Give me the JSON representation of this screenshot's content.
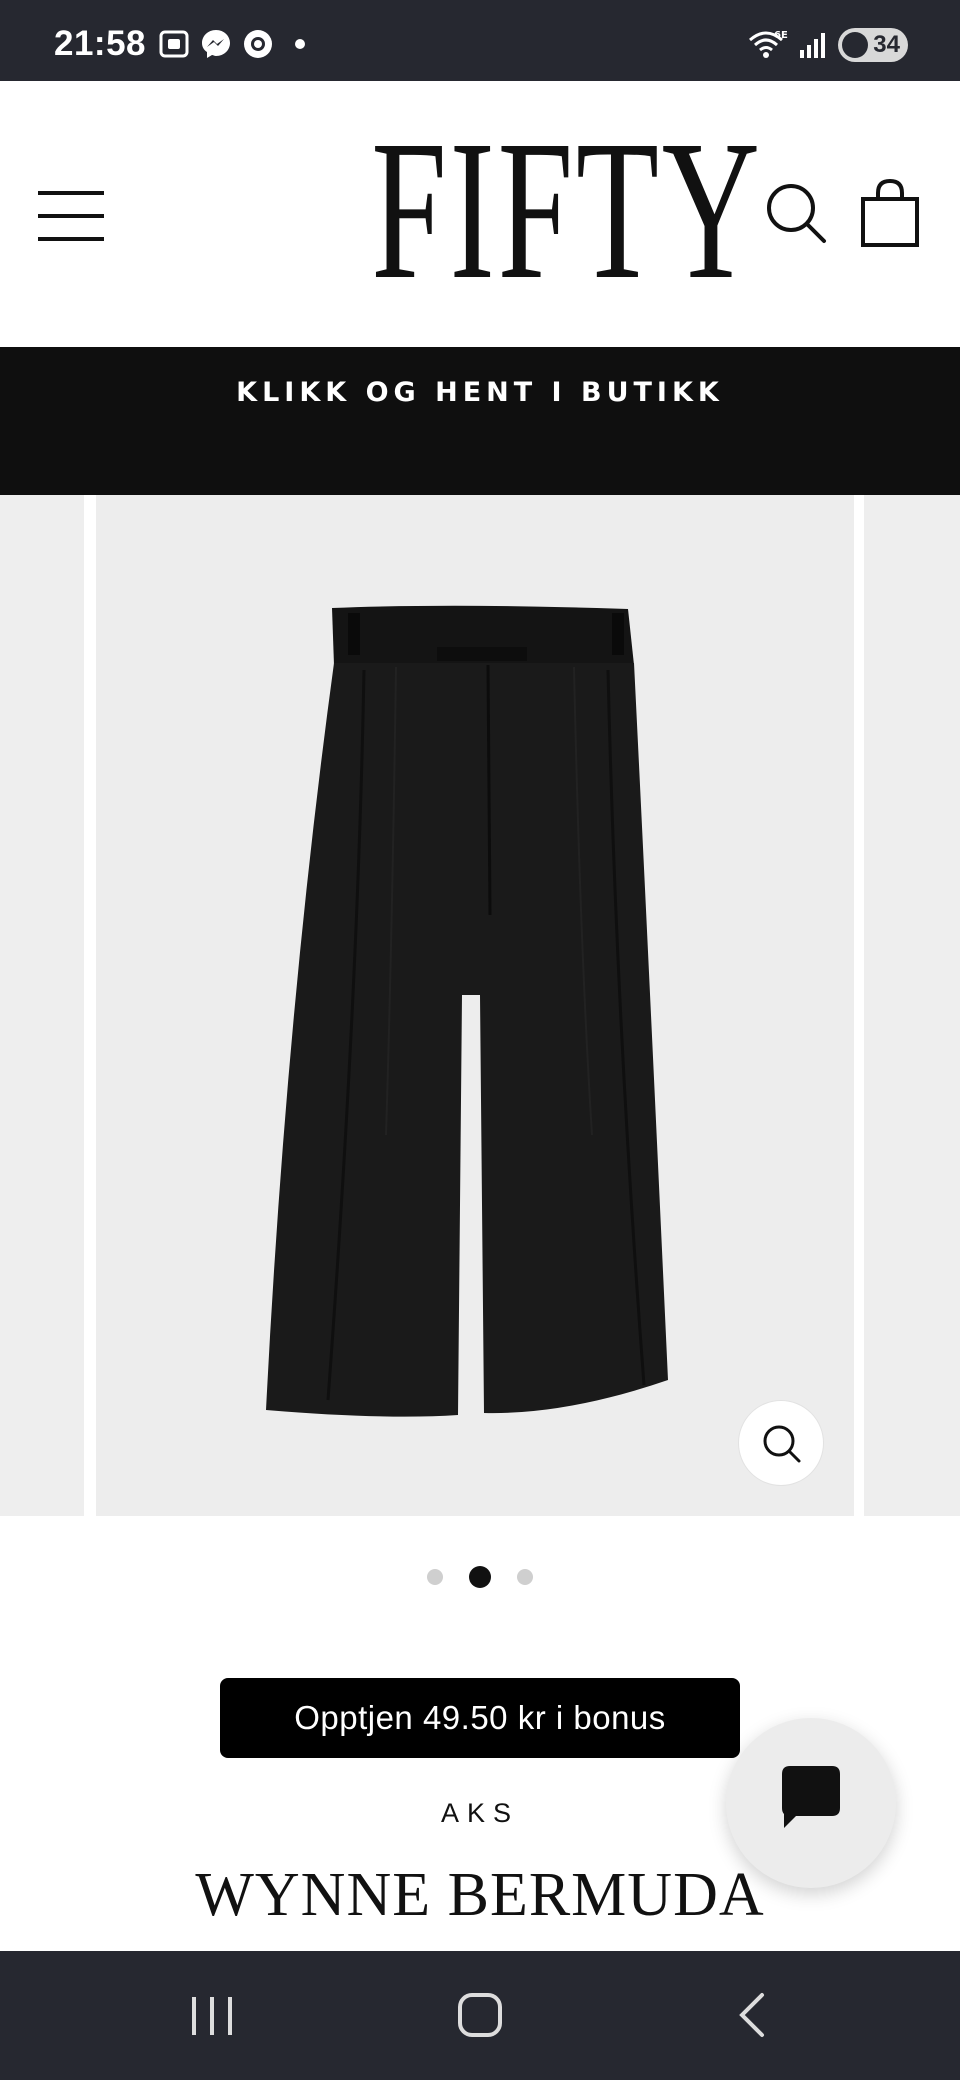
{
  "status_bar": {
    "time": "21:58",
    "left_icons": [
      "screenshot-icon",
      "messenger-icon",
      "chrome-icon",
      "notification-dot-icon"
    ],
    "right_icons": [
      "wifi-6e-icon",
      "signal-icon"
    ],
    "battery": "34"
  },
  "header": {
    "logo": "FIFTY",
    "icons": [
      "menu-icon",
      "search-icon",
      "shopping-bag-icon"
    ]
  },
  "banner": {
    "text": "KLIKK OG HENT I BUTIKK"
  },
  "gallery": {
    "slide_count": 3,
    "active_slide": 2,
    "zoom_icon": "zoom-icon"
  },
  "product": {
    "bonus": "Opptjen 49.50 kr i bonus",
    "brand": "AKS",
    "title": "WYNNE BERMUDA"
  },
  "chat": {
    "icon": "chat-bubble-icon"
  },
  "nav_bar": {
    "icons": [
      "recent-apps-icon",
      "home-icon",
      "back-icon"
    ]
  },
  "colors": {
    "status_bar": "#262830",
    "banner": "#0f0f0f",
    "gallery_bg": "#ededed",
    "accent": "#000000"
  }
}
